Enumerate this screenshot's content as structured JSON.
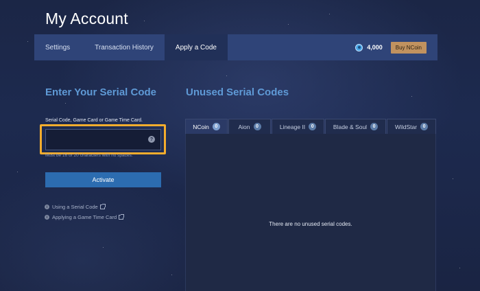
{
  "page": {
    "title": "My Account"
  },
  "nav": {
    "tabs": [
      {
        "label": "Settings",
        "active": false
      },
      {
        "label": "Transaction History",
        "active": false
      },
      {
        "label": "Apply a Code",
        "active": true
      }
    ],
    "balance": "4,000",
    "balance_icon": "ncoin-icon",
    "buy_label": "Buy NCoin"
  },
  "serial": {
    "heading": "Enter Your Serial Code",
    "field_label": "Serial Code, Game Card or Game Time Card.",
    "value": "",
    "placeholder": "",
    "hint": "Must be 16 or 20 characters with no spaces.",
    "activate_label": "Activate",
    "links": [
      {
        "label": "Using a Serial Code"
      },
      {
        "label": "Applying a Game Time Card"
      }
    ]
  },
  "unused": {
    "heading": "Unused Serial Codes",
    "tabs": [
      {
        "label": "NCoin",
        "count": "0",
        "active": true
      },
      {
        "label": "Aion",
        "count": "0",
        "active": false
      },
      {
        "label": "Lineage II",
        "count": "0",
        "active": false
      },
      {
        "label": "Blade & Soul",
        "count": "0",
        "active": false
      },
      {
        "label": "WildStar",
        "count": "0",
        "active": false
      }
    ],
    "empty_message": "There are no unused serial codes."
  },
  "colors": {
    "accent": "#5f9ad6",
    "nav_bg": "#2f4478",
    "highlight": "#f5ad2d",
    "buy_button": "#c1925f",
    "activate_button": "#2c6cb0"
  }
}
